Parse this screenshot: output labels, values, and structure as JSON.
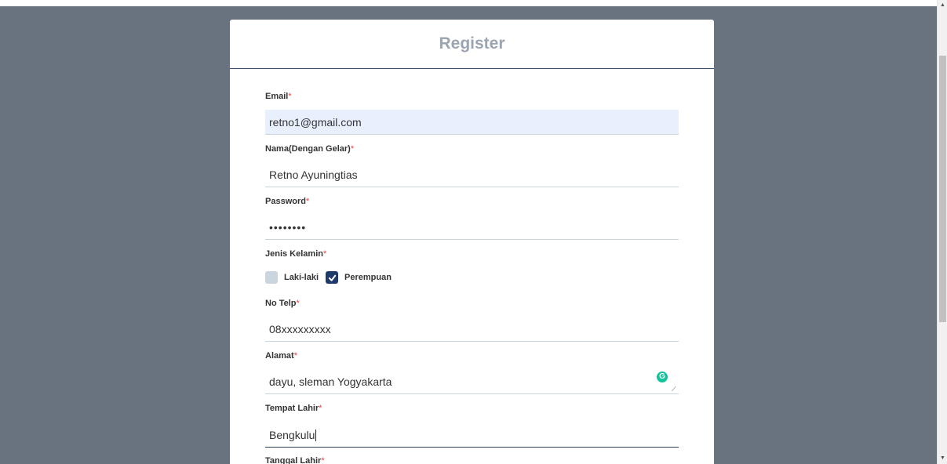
{
  "header": {
    "title": "Register"
  },
  "form": {
    "email": {
      "label": "Email",
      "required_mark": "*",
      "value": "retno1@gmail.com"
    },
    "nama": {
      "label": "Nama(Dengan Gelar)",
      "required_mark": "*",
      "value": "Retno Ayuningtias"
    },
    "password": {
      "label": "Password",
      "required_mark": "*",
      "value": "••••••••"
    },
    "gender": {
      "label": "Jenis Kelamin",
      "required_mark": "*",
      "options": [
        {
          "label": "Laki-laki",
          "checked": false
        },
        {
          "label": "Perempuan",
          "checked": true
        }
      ]
    },
    "telp": {
      "label": "No Telp",
      "required_mark": "*",
      "value": "08xxxxxxxxx"
    },
    "alamat": {
      "label": "Alamat",
      "required_mark": "*",
      "value": "dayu, sleman Yogyakarta"
    },
    "tempat_lahir": {
      "label": "Tempat Lahir",
      "required_mark": "*",
      "value": "Bengkulu"
    },
    "tanggal_lahir": {
      "label": "Tanggal Lahir",
      "required_mark": "*"
    }
  },
  "colors": {
    "background": "#68737f",
    "title": "#9aa5b1",
    "checkbox_checked": "#1e3a6b",
    "required": "#e53e3e",
    "autofill": "#e8f0fe"
  },
  "icons": {
    "checkmark": "check-icon",
    "grammarly": "grammarly-icon",
    "scroll_up": "triangle-up-icon",
    "scroll_down": "triangle-down-icon"
  }
}
